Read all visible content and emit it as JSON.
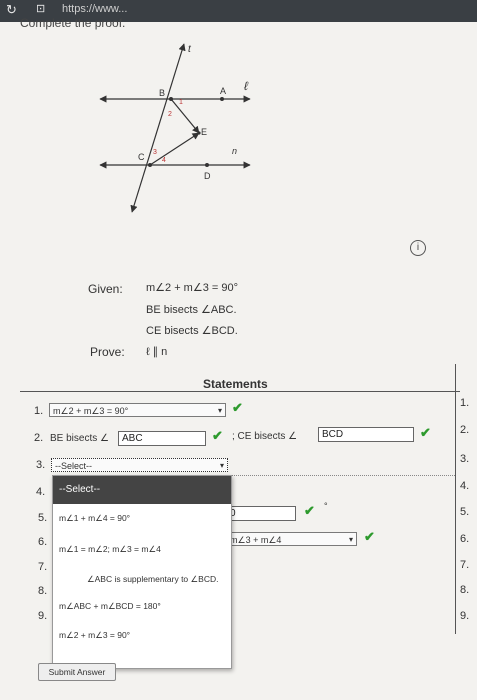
{
  "browser": {
    "url": "https://www..."
  },
  "instruction": "Complete the proof.",
  "figure": {
    "labels": {
      "t": "t",
      "B": "B",
      "A": "A",
      "l": "ℓ",
      "E": "E",
      "n": "n",
      "C": "C",
      "D": "D",
      "a1": "1",
      "a2": "2",
      "a3": "3",
      "a4": "4"
    }
  },
  "given": {
    "label": "Given:",
    "lines": [
      "m∠2 + m∠3 = 90°",
      "BE bisects ∠ABC.",
      "CE bisects ∠BCD."
    ]
  },
  "prove": {
    "label": "Prove:",
    "statement": "ℓ ∥ n"
  },
  "info_icon": "i",
  "statements_header": "Statements",
  "row_numbers": [
    "1.",
    "2.",
    "3.",
    "4.",
    "5.",
    "6.",
    "7.",
    "8.",
    "9."
  ],
  "left_numbers": [
    "1.",
    "2.",
    "3.",
    "4.",
    "5.",
    "6.",
    "7.",
    "8.",
    "9."
  ],
  "rows": {
    "r1": {
      "select_value": "m∠2 + m∠3 = 90°"
    },
    "r2": {
      "prefix": "BE bisects ∠",
      "input1": "ABC",
      "mid": "; CE bisects ∠",
      "input2": "BCD"
    },
    "r3": {
      "select_value": "--Select--"
    },
    "r5": {
      "input_value": "0"
    },
    "r6": {
      "select_value": "m∠3 + m∠4"
    }
  },
  "dropdown": {
    "header": "--Select--",
    "options": [
      "m∠1 + m∠4 = 90°",
      "m∠1 = m∠2; m∠3 = m∠4",
      "∠ABC is supplementary to ∠BCD.",
      "m∠ABC + m∠BCD = 180°",
      "m∠2 + m∠3 = 90°"
    ]
  },
  "submit_label": "Submit Answer",
  "check_mark": "✔",
  "caret": "▾"
}
